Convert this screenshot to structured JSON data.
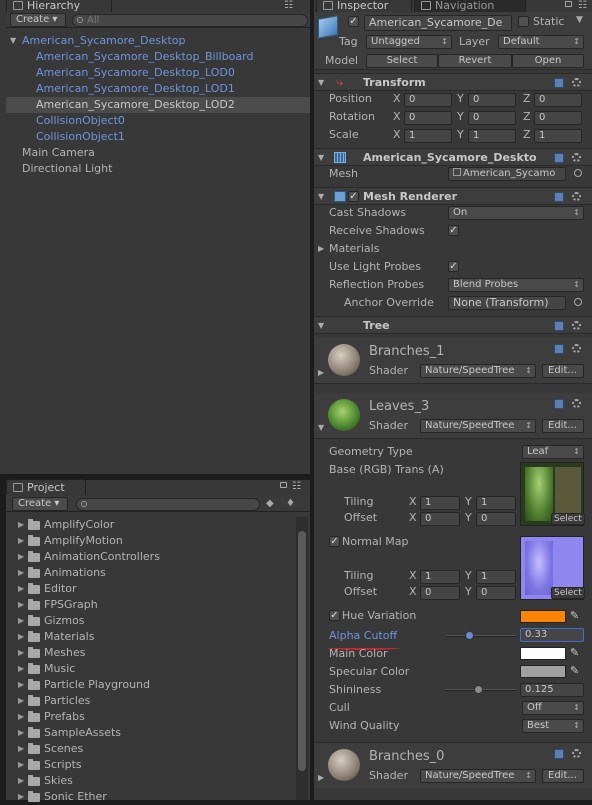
{
  "hierarchy": {
    "tab_label": "Hierarchy",
    "create_label": "Create",
    "search_placeholder": "All",
    "items": [
      {
        "label": "American_Sycamore_Desktop",
        "color": "#6d95e0"
      },
      {
        "label": "American_Sycamore_Desktop_Billboard",
        "color": "#6d95e0"
      },
      {
        "label": "American_Sycamore_Desktop_LOD0",
        "color": "#6d95e0"
      },
      {
        "label": "American_Sycamore_Desktop_LOD1",
        "color": "#6d95e0"
      },
      {
        "label": "American_Sycamore_Desktop_LOD2",
        "color": "#c8c8c8"
      },
      {
        "label": "CollisionObject0",
        "color": "#6d95e0"
      },
      {
        "label": "CollisionObject1",
        "color": "#6d95e0"
      },
      {
        "label": "Main Camera",
        "color": "#b4b4b4"
      },
      {
        "label": "Directional Light",
        "color": "#b4b4b4"
      }
    ]
  },
  "project": {
    "tab_label": "Project",
    "create_label": "Create",
    "folders": [
      "AmplifyColor",
      "AmplifyMotion",
      "AnimationControllers",
      "Animations",
      "Editor",
      "FPSGraph",
      "Gizmos",
      "Materials",
      "Meshes",
      "Music",
      "Particle Playground",
      "Particles",
      "Prefabs",
      "SampleAssets",
      "Scenes",
      "Scripts",
      "Skies",
      "Sonic Ether"
    ]
  },
  "inspector": {
    "tab_label": "Inspector",
    "nav_tab_label": "Navigation",
    "object_name": "American_Sycamore_De",
    "static_label": "Static",
    "tag_label": "Tag",
    "tag_value": "Untagged",
    "layer_label": "Layer",
    "layer_value": "Default",
    "model_label": "Model",
    "select_label": "Select",
    "revert_label": "Revert",
    "open_label": "Open",
    "transform": {
      "title": "Transform",
      "position_label": "Position",
      "rotation_label": "Rotation",
      "scale_label": "Scale",
      "x": "X",
      "y": "Y",
      "z": "Z",
      "position": [
        "0",
        "0",
        "0"
      ],
      "rotation": [
        "0",
        "0",
        "0"
      ],
      "scale": [
        "1",
        "1",
        "1"
      ]
    },
    "mesh_filter": {
      "title": "American_Sycamore_Deskto",
      "mesh_label": "Mesh",
      "mesh_value": "American_Sycamo"
    },
    "mesh_renderer": {
      "title": "Mesh Renderer",
      "cast_shadows_label": "Cast Shadows",
      "cast_shadows_value": "On",
      "receive_shadows_label": "Receive Shadows",
      "materials_label": "Materials",
      "light_probes_label": "Use Light Probes",
      "reflection_probes_label": "Reflection Probes",
      "reflection_probes_value": "Blend Probes",
      "anchor_override_label": "Anchor Override",
      "anchor_override_value": "None (Transform)"
    },
    "tree": {
      "title": "Tree"
    },
    "materials": [
      {
        "name": "Branches_1",
        "shader_label": "Shader",
        "shader_value": "Nature/SpeedTree",
        "edit_label": "Edit..."
      },
      {
        "name": "Leaves_3",
        "shader_label": "Shader",
        "shader_value": "Nature/SpeedTree",
        "edit_label": "Edit..."
      },
      {
        "name": "Branches_0",
        "shader_label": "Shader",
        "shader_value": "Nature/SpeedTree",
        "edit_label": "Edit..."
      }
    ],
    "leaves_props": {
      "geometry_type_label": "Geometry Type",
      "geometry_type_value": "Leaf",
      "base_label": "Base (RGB) Trans (A)",
      "tiling_label": "Tiling",
      "offset_label": "Offset",
      "x": "X",
      "y": "Y",
      "base_tiling": [
        "1",
        "1"
      ],
      "base_offset": [
        "0",
        "0"
      ],
      "select_label": "Select",
      "normal_map_label": "Normal Map",
      "normal_tiling": [
        "1",
        "1"
      ],
      "normal_offset": [
        "0",
        "0"
      ],
      "hue_variation_label": "Hue Variation",
      "hue_color": "#ff8400",
      "alpha_cutoff_label": "Alpha Cutoff",
      "alpha_cutoff_value": "0.33",
      "alpha_cutoff_fraction": 0.33,
      "main_color_label": "Main Color",
      "main_color": "#ffffff",
      "specular_color_label": "Specular Color",
      "specular_color": "#a0a0a0",
      "shininess_label": "Shininess",
      "shininess_value": "0.125",
      "shininess_fraction": 0.125,
      "cull_label": "Cull",
      "cull_value": "Off",
      "wind_quality_label": "Wind Quality",
      "wind_quality_value": "Best"
    }
  }
}
